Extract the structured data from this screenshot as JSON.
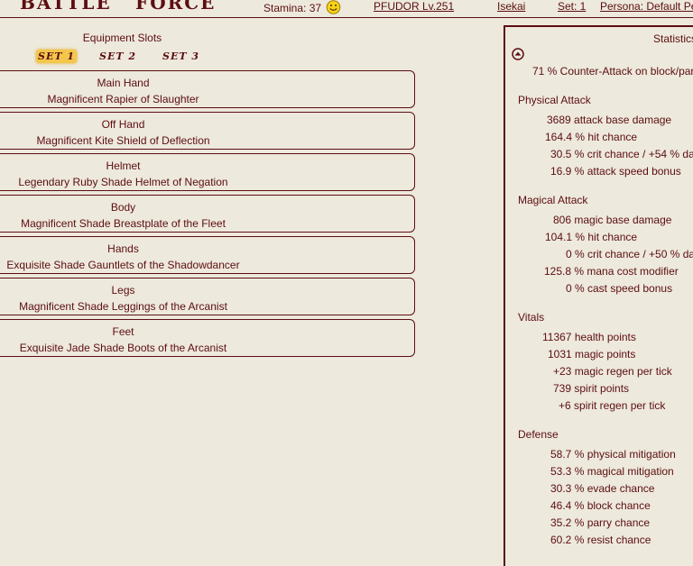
{
  "header": {
    "logo_left": "BATTLE",
    "logo_right": "FORCE",
    "stamina_label": "Stamina: 37",
    "stamina_icon": "smiley-face-icon",
    "character": "PFUDOR Lv.251",
    "world": "Isekai",
    "set": "Set: 1",
    "persona": "Persona: Default Pe"
  },
  "equipment": {
    "title": "Equipment Slots",
    "sets": [
      "SET 1",
      "SET 2",
      "SET 3"
    ],
    "active_set": 0,
    "slots": [
      {
        "label": "Main Hand",
        "item": "Magnificent Rapier of Slaughter"
      },
      {
        "label": "Off Hand",
        "item": "Magnificent Kite Shield of Deflection"
      },
      {
        "label": "Helmet",
        "item": "Legendary Ruby Shade Helmet of Negation"
      },
      {
        "label": "Body",
        "item": "Magnificent Shade Breastplate of the Fleet"
      },
      {
        "label": "Hands",
        "item": "Exquisite Shade Gauntlets of the Shadowdancer"
      },
      {
        "label": "Legs",
        "item": "Magnificent Shade Leggings of the Arcanist"
      },
      {
        "label": "Feet",
        "item": "Exquisite Jade Shade Boots of the Arcanist"
      }
    ]
  },
  "statistics": {
    "title": "Statistics",
    "toggle_icon": "collapse-arrow-icon",
    "top_line": "71 % Counter-Attack on block/par",
    "physical": {
      "title": "Physical Attack",
      "lines": [
        "3689 attack base damage",
        "164.4 % hit chance",
        "30.5 % crit chance / +54 % da",
        "16.9 % attack speed bonus"
      ]
    },
    "magical": {
      "title": "Magical Attack",
      "lines": [
        "806 magic base damage",
        "104.1 % hit chance",
        "0 % crit chance / +50 % da",
        "125.8 % mana cost modifier",
        "0 % cast speed bonus"
      ]
    },
    "vitals": {
      "title": "Vitals",
      "lines": [
        "11367 health points",
        "1031 magic points",
        "+23 magic regen per tick",
        "739 spirit points",
        "+6 spirit regen per tick"
      ]
    },
    "defense": {
      "title": "Defense",
      "lines": [
        "58.7 % physical mitigation",
        "53.3 % magical mitigation",
        "30.3 % evade chance",
        "46.4 % block chance",
        "35.2 % parry chance",
        "60.2 % resist chance"
      ]
    }
  }
}
